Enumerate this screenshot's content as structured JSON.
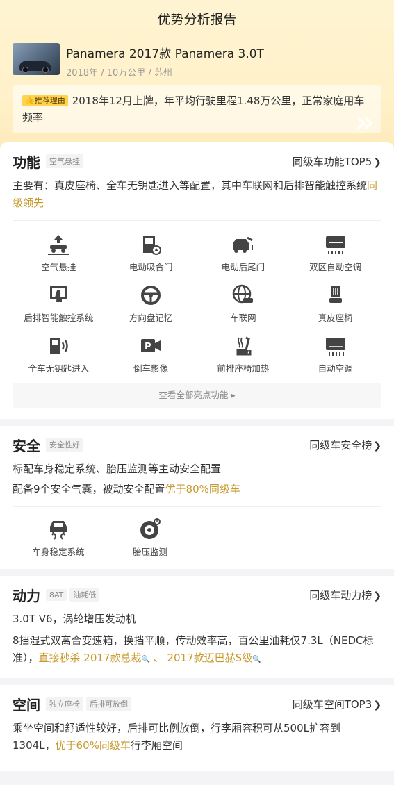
{
  "page_title": "优势分析报告",
  "car": {
    "name": "Panamera 2017款 Panamera 3.0T",
    "meta": "2018年 / 10万公里 / 苏州"
  },
  "reason": {
    "tag": "推荐理由",
    "text": "2018年12月上牌，年平均行驶里程1.48万公里，正常家庭用车频率"
  },
  "function": {
    "title": "功能",
    "tag": "空气悬挂",
    "link": "同级车功能TOP5",
    "desc_prefix": "主要有：真皮座椅、全车无钥匙进入等配置，其中车联网和后排智能触控系统",
    "desc_highlight": "同级领先",
    "features": [
      {
        "label": "空气悬挂",
        "icon": "air-suspension-icon"
      },
      {
        "label": "电动吸合门",
        "icon": "soft-close-door-icon"
      },
      {
        "label": "电动后尾门",
        "icon": "power-tailgate-icon"
      },
      {
        "label": "双区自动空调",
        "icon": "dual-zone-ac-icon"
      },
      {
        "label": "后排智能触控系统",
        "icon": "rear-touch-control-icon"
      },
      {
        "label": "方向盘记忆",
        "icon": "steering-wheel-memory-icon"
      },
      {
        "label": "车联网",
        "icon": "connected-car-icon"
      },
      {
        "label": "真皮座椅",
        "icon": "leather-seat-icon"
      },
      {
        "label": "全车无钥匙进入",
        "icon": "keyless-entry-icon"
      },
      {
        "label": "倒车影像",
        "icon": "reverse-camera-icon"
      },
      {
        "label": "前排座椅加热",
        "icon": "seat-heating-icon"
      },
      {
        "label": "自动空调",
        "icon": "auto-ac-icon"
      }
    ],
    "more_button": "查看全部亮点功能 ▸"
  },
  "safety": {
    "title": "安全",
    "tag": "安全性好",
    "link": "同级车安全榜",
    "desc1": "标配车身稳定系统、胎压监测等主动安全配置",
    "desc2_prefix": "配备9个安全气囊，被动安全配置",
    "desc2_highlight": "优于80%同级车",
    "features": [
      {
        "label": "车身稳定系统",
        "icon": "stability-control-icon"
      },
      {
        "label": "胎压监测",
        "icon": "tire-pressure-icon"
      }
    ]
  },
  "power": {
    "title": "动力",
    "tags": [
      "8AT",
      "油耗低"
    ],
    "link": "同级车动力榜",
    "desc1": "3.0T V6，涡轮增压发动机",
    "desc2_prefix": "8挡湿式双离合变速箱，换挡平顺，传动效率高，百公里油耗仅7.3L（NEDC标准），",
    "desc2_highlight": "直接秒杀 2017款总裁",
    "desc2_sep": " 、 ",
    "desc2_highlight2": "2017款迈巴赫S级"
  },
  "space": {
    "title": "空间",
    "tags": [
      "独立座椅",
      "后排可放倒"
    ],
    "link": "同级车空间TOP3",
    "desc_prefix": "乘坐空间和舒适性较好，后排可比例放倒，行李厢容积可从500L扩容到1304L，",
    "desc_highlight": "优于60%同级车",
    "desc_suffix": "行李厢空间"
  },
  "colors": {
    "accent_gold": "#c7992b",
    "tag_yellow": "#ffd34e",
    "header_bg": "#fff1c9"
  }
}
